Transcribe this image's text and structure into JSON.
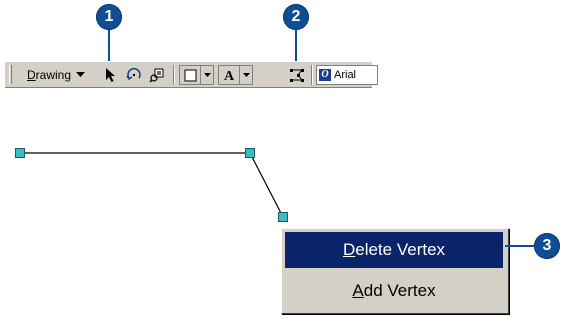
{
  "callouts": [
    "1",
    "2",
    "3"
  ],
  "toolbar": {
    "drawing_label": "Drawing",
    "drawing_underline": "D",
    "drawing_rest": "rawing",
    "tools": [
      "select-elements-icon",
      "rotate-icon",
      "zoom-to-selected-icon",
      "rectangle-icon",
      "text-icon",
      "edit-vertices-icon"
    ],
    "font_name": "Arial"
  },
  "context_menu": {
    "items": [
      {
        "underline": "D",
        "rest": "elete Vertex",
        "label": "Delete Vertex",
        "selected": true
      },
      {
        "underline": "A",
        "rest": "dd Vertex",
        "label": "Add Vertex",
        "selected": false
      }
    ]
  },
  "colors": {
    "callout": "#0f4e95",
    "vertex": "#3cbcc0",
    "menu_highlight": "#0a246a",
    "toolbar_face": "#d4d0c8"
  }
}
